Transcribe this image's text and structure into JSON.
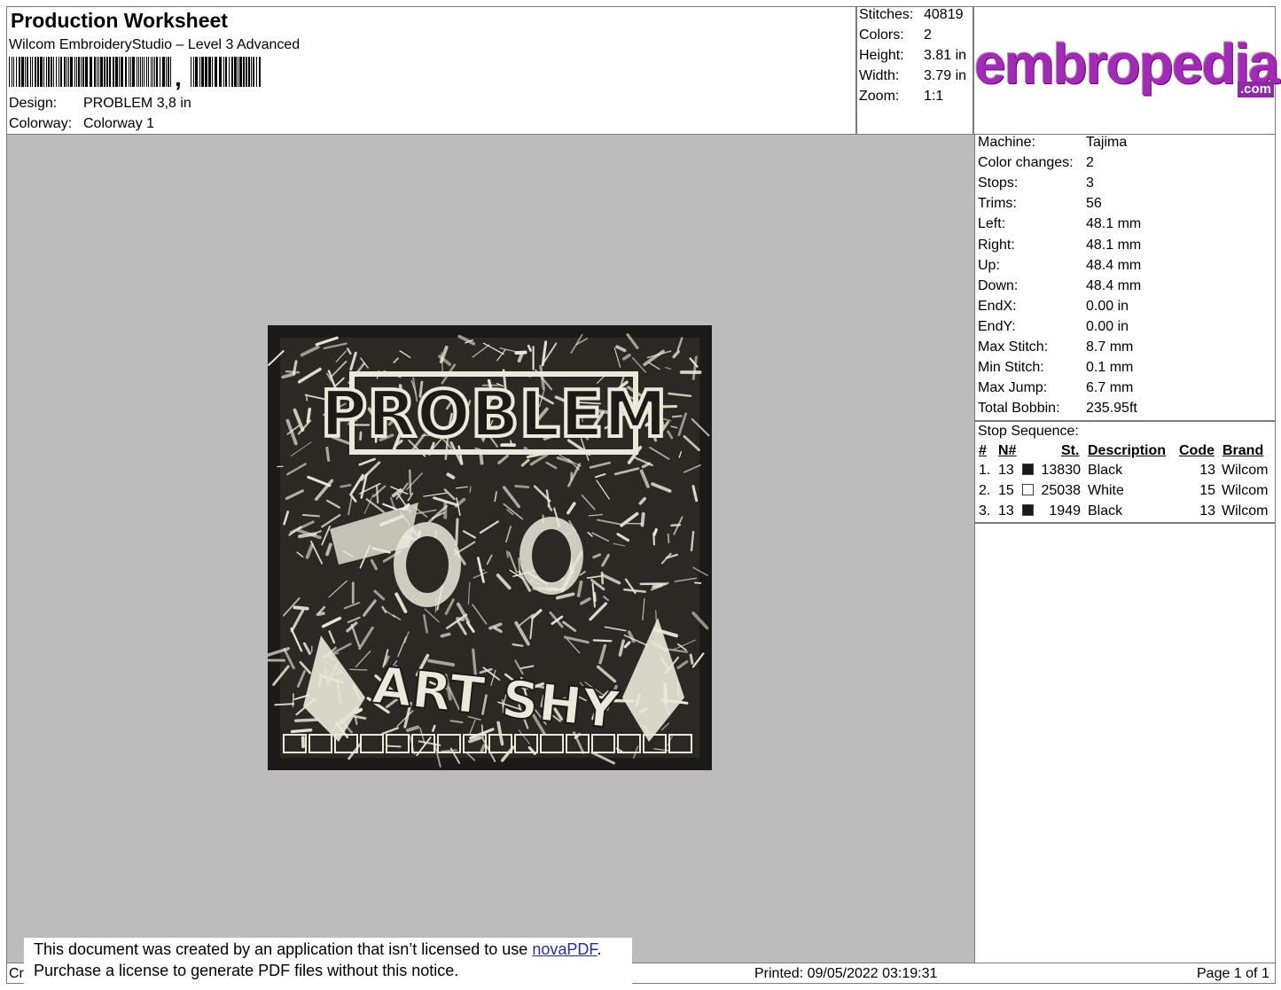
{
  "header": {
    "title": "Production Worksheet",
    "software": "Wilcom EmbroideryStudio – Level 3 Advanced",
    "barcode_text": ",",
    "design_label": "Design:",
    "design_value": "PROBLEM 3,8 in",
    "colorway_label": "Colorway:",
    "colorway_value": "Colorway 1"
  },
  "summary": [
    {
      "label": "Stitches:",
      "value": "40819"
    },
    {
      "label": "Colors:",
      "value": "2"
    },
    {
      "label": "Height:",
      "value": "3.81 in"
    },
    {
      "label": "Width:",
      "value": "3.79 in"
    },
    {
      "label": "Zoom:",
      "value": "1:1"
    }
  ],
  "logo": {
    "main": "embropedia",
    "sub": ".com",
    "color": "#a12bb5"
  },
  "details": [
    {
      "label": "Machine:",
      "value": "Tajima"
    },
    {
      "label": "Color changes:",
      "value": "2"
    },
    {
      "label": "Stops:",
      "value": "3"
    },
    {
      "label": "Trims:",
      "value": "56"
    },
    {
      "label": "Left:",
      "value": "48.1 mm"
    },
    {
      "label": "Right:",
      "value": "48.1 mm"
    },
    {
      "label": "Up:",
      "value": "48.4 mm"
    },
    {
      "label": "Down:",
      "value": "48.4 mm"
    },
    {
      "label": "EndX:",
      "value": "0.00 in"
    },
    {
      "label": "EndY:",
      "value": "0.00 in"
    },
    {
      "label": "Max Stitch:",
      "value": "8.7 mm"
    },
    {
      "label": "Min Stitch:",
      "value": "0.1 mm"
    },
    {
      "label": "Max Jump:",
      "value": "6.7 mm"
    },
    {
      "label": "Total Bobbin:",
      "value": "235.95ft"
    }
  ],
  "stop_sequence": {
    "title": "Stop Sequence:",
    "headers": {
      "num": "#",
      "needle": "N#",
      "stitches": "St.",
      "description": "Description",
      "code": "Code",
      "brand": "Brand"
    },
    "rows": [
      {
        "num": "1.",
        "needle": "13",
        "swatch": "#1a1a1a",
        "stitches": "13830",
        "description": "Black",
        "code": "13",
        "brand": "Wilcom"
      },
      {
        "num": "2.",
        "needle": "15",
        "swatch": "#ffffff",
        "stitches": "25038",
        "description": "White",
        "code": "15",
        "brand": "Wilcom"
      },
      {
        "num": "3.",
        "needle": "13",
        "swatch": "#1a1a1a",
        "stitches": "1949",
        "description": "Black",
        "code": "13",
        "brand": "Wilcom"
      }
    ]
  },
  "design_preview": {
    "text_top": "PROBLEM",
    "text_bottom": "ART SHY",
    "canvas_color": "#bcbcbc",
    "thread_black": "#1c1b18",
    "thread_white": "#e9ead9"
  },
  "footer": {
    "created_prefix": "Cr",
    "notice_line1_pre": "This document was created by an application that isn’t licensed to use ",
    "notice_link": "novaPDF",
    "notice_line1_post": ".",
    "notice_line2": "Purchase a license to generate PDF files without this notice.",
    "printed": "Printed: 09/05/2022 03:19:31",
    "page": "Page 1 of 1"
  }
}
